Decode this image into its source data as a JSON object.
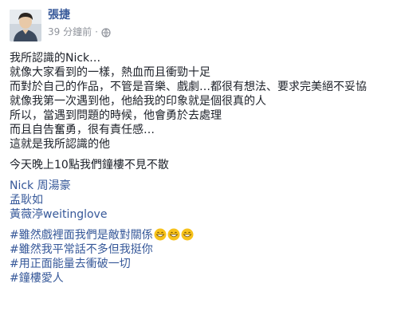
{
  "post": {
    "author": "張捷",
    "timestamp": "39 分鐘前",
    "separator": "·",
    "privacy_icon": "globe-icon"
  },
  "body": {
    "paragraph1": [
      "我所認識的Nick…",
      "就像大家看到的一樣，熱血而且衝勁十足",
      "而對於自己的作品，不管是音樂、戲劇…都很有想法、要求完美絕不妥協",
      "就像我第一次遇到他，他給我的印象就是個很真的人",
      "所以，當遇到問題的時候，他會勇於去處理",
      "而且自告奮勇，很有責任感…",
      "這就是我所認識的他"
    ],
    "paragraph2": "今天晚上10點我們鐘樓不見不散",
    "tags": [
      "Nick 周湯豪",
      "孟耿如",
      "黃薇渟weitinglove"
    ],
    "hashtags": [
      "#雖然戲裡面我們是敵對關係",
      "#雖然我平常話不多但我挺你",
      "#用正面能量去衝破一切",
      "#鐘樓愛人"
    ],
    "emoji_name": "grinning-face-emoji"
  }
}
